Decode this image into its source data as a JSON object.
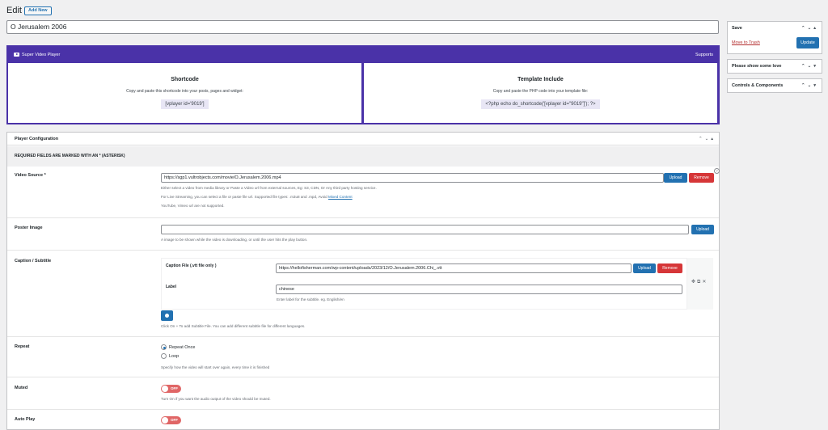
{
  "header": {
    "title": "Edit",
    "add_new": "Add New"
  },
  "post_title": "O Jerusalem 2006",
  "svp": {
    "brand": "Super Video Player",
    "supports": "Supports",
    "shortcode": {
      "title": "Shortcode",
      "desc": "Copy and paste this shortcode into your posts, pages and widget:",
      "code": "[vplayer id='9019']"
    },
    "template": {
      "title": "Template Include",
      "desc": "Copy and paste the PHP code into your template file:",
      "code": "<?php echo do_shortcode('[vplayer id=\"9019\"]'); ?>"
    }
  },
  "sidebar": {
    "save": {
      "title": "Save",
      "trash": "Move to Trash",
      "update": "Update"
    },
    "love": {
      "title": "Please show some love"
    },
    "controls": {
      "title": "Controls & Components"
    }
  },
  "config": {
    "title": "Player Configuration",
    "required_note": "REQUIRED FIELDS ARE MARKED WITH AN * (ASTERISK)",
    "video_source": {
      "label": "Video Source *",
      "value": "https://sgp1.vultrobjects.com/movie/O.Jerusalem.2006.mp4",
      "upload": "Upload",
      "remove": "Remove",
      "hint1": "Either select a video from media library or Paste a Video url from external sources, Eg: S3, CDN, Or Any third party hosting service.",
      "hint2": "For Live Streaming, you can select a file or paste file url. Supported file types: .m3u8 and .mpd, Avoid",
      "hint2_link": "Mixed Content",
      "hint3": "YouTube, Vimeo url are not supported."
    },
    "poster": {
      "label": "Poster Image",
      "value": "",
      "upload": "Upload",
      "hint": "A image to be shown while the video is downloading, or until the user hits the play button."
    },
    "caption": {
      "label": "Caption / Subtitle",
      "file_label": "Caption File (.vtt file only )",
      "file_value": "https://hellofisherman.com/wp-content/uploads/2023/12/O.Jerusalem.2006.Chi_.vtt",
      "upload": "Upload",
      "remove": "Remove",
      "sub_label": "Label",
      "sub_value": "chinese",
      "sub_hint": "Enter label for the subtitle. eg. English/en",
      "add_hint": "Click On + To add Subtitle File. You can add different subtitle file for different languages."
    },
    "repeat": {
      "label": "Repeat",
      "option1": "Repeat Once",
      "option2": "Loop",
      "selected": "Repeat Once",
      "hint": "Specify how the video will start over again, every time it is finished"
    },
    "muted": {
      "label": "Muted",
      "toggle": "OFF",
      "hint": "Turn On if you want the audio output of the video should be muted."
    },
    "autoplay": {
      "label": "Auto Play",
      "toggle": "OFF"
    }
  }
}
